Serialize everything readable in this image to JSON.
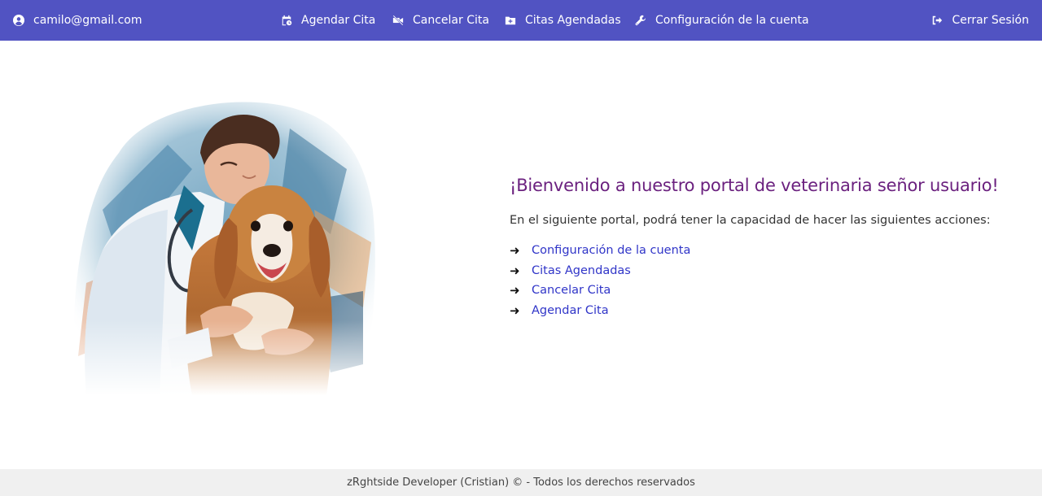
{
  "navbar": {
    "user_email": "camilo@gmail.com",
    "user_icon": "user-circle-icon",
    "items": [
      {
        "label": "Agendar Cita",
        "icon": "calendar-clock-icon"
      },
      {
        "label": "Cancelar Cita",
        "icon": "video-slash-icon"
      },
      {
        "label": "Citas Agendadas",
        "icon": "folder-plus-icon"
      },
      {
        "label": "Configuración de la cuenta",
        "icon": "wrench-icon"
      }
    ],
    "logout_label": "Cerrar Sesión",
    "logout_icon": "sign-out-icon",
    "background_color": "#5153c2"
  },
  "hero": {
    "image": "veterinarian-hugging-dog-watercolor"
  },
  "welcome": {
    "title": "¡Bienvenido a nuestro portal de veterinaria señor usuario!",
    "intro": "En el siguiente portal, podrá tener la capacidad de hacer las siguientes acciones:",
    "actions": [
      "Configuración de la cuenta",
      "Citas Agendadas",
      "Cancelar Cita",
      "Agendar Cita"
    ],
    "title_color": "#6b217f",
    "link_color": "#3035c8"
  },
  "footer": {
    "text": "zRghtside Developer (Cristian) © - Todos los derechos reservados"
  }
}
